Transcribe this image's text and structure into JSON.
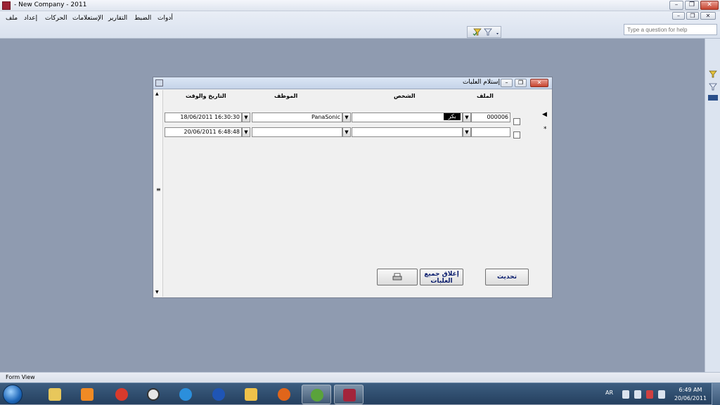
{
  "app": {
    "title": "- New Company - 2011",
    "help_placeholder": "Type a question for help"
  },
  "menu": {
    "items": [
      "ملف",
      "إعداد",
      "الحركات",
      "الإستعلامات",
      "التقارير",
      "الضبط",
      "أدوات"
    ]
  },
  "form": {
    "title": "إستلام العلبات",
    "headers": {
      "file": "الملف",
      "person": "الشخص",
      "employee": "الموظف",
      "datetime": "التاريخ والوقت"
    },
    "rows": [
      {
        "file": "000006",
        "person": "بكر",
        "employee": "PanaSonic",
        "datetime": "18/06/2011 16:30:30"
      },
      {
        "file": "",
        "person": "",
        "employee": "",
        "datetime": "20/06/2011 6:48:48"
      }
    ],
    "buttons": {
      "refresh": "تحديث",
      "close_all": "إغلاق جميع العلبات"
    }
  },
  "status": {
    "view": "Form View"
  },
  "tray": {
    "lang": "AR",
    "time": "6:49 AM",
    "date": "20/06/2011"
  },
  "colors": {
    "workspace": "#8f9bb0",
    "button_text": "#0b1e6e"
  }
}
